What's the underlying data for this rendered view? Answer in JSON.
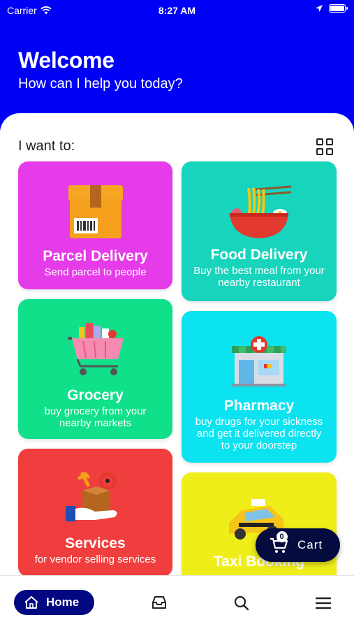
{
  "status_bar": {
    "carrier": "Carrier",
    "time": "8:27 AM"
  },
  "header": {
    "title": "Welcome",
    "subtitle": "How can I help you today?"
  },
  "section_label": "I want to:",
  "services": {
    "parcel": {
      "title": "Parcel Delivery",
      "desc": "Send parcel to people",
      "color": "#E53BE8"
    },
    "food": {
      "title": "Food Delivery",
      "desc": "Buy the best meal from your nearby restaurant",
      "color": "#17D4BD"
    },
    "grocery": {
      "title": "Grocery",
      "desc": "buy grocery from your nearby markets",
      "color": "#10E08A"
    },
    "pharmacy": {
      "title": "Pharmacy",
      "desc": "buy drugs for your sickness and get it delivered directly to your doorstep",
      "color": "#0BE3F0"
    },
    "services": {
      "title": "Services",
      "desc": "for vendor selling services",
      "color": "#F03E3E"
    },
    "taxi": {
      "title": "Taxi Booking",
      "color": "#F0EE19"
    }
  },
  "cart": {
    "label": "Cart",
    "count": "0"
  },
  "nav": {
    "home_label": "Home"
  }
}
